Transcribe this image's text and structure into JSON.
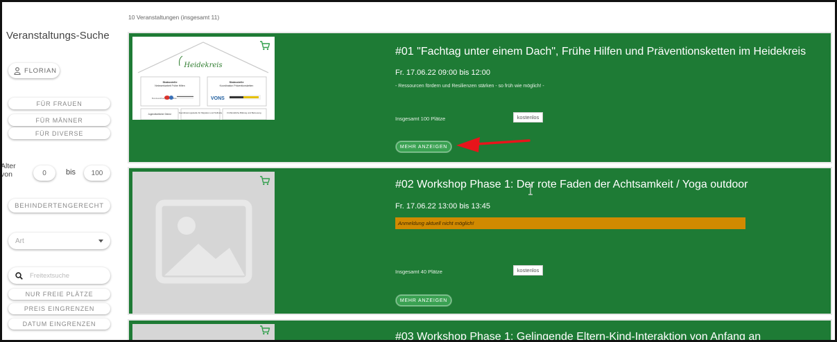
{
  "sidebar": {
    "title": "Veranstaltungs-Suche",
    "user_label": "FLORIAN",
    "gender_buttons": [
      "FÜR FRAUEN",
      "FÜR MÄNNER",
      "FÜR DIVERSE"
    ],
    "age": {
      "label": "Alter von",
      "from": "0",
      "to_label": "bis",
      "to": "100"
    },
    "accessible_label": "BEHINDERTENGERECHT",
    "type_select": {
      "selected": "Art"
    },
    "search": {
      "placeholder": "Freitextsuche"
    },
    "filters": [
      "NUR FREIE PLÄTZE",
      "PREIS EINGRENZEN",
      "DATUM EINGRENZEN"
    ]
  },
  "results": {
    "count_text": "10 Veranstaltungen (insgesamt 11)"
  },
  "events": [
    {
      "title": "#01 \"Fachtag unter einem Dach\", Frühe Hilfen und Präventionsketten im Heidekreis",
      "date": "Fr. 17.06.22 09:00 bis 12:00",
      "description": "- Ressourcen fördern und Resilienzen stärken - so früh wie möglich! -",
      "places": "Insgesamt 100 Plätze",
      "price": "kostenlos",
      "more_label": "MEHR ANZEIGEN",
      "image": {
        "logo": "Heidekreis",
        "boxes": [
          {
            "title": "Stabsstelle",
            "subtitle": "Netzwerkarbeit Frühe Hilfen"
          },
          {
            "title": "Stabsstelle",
            "subtitle": "Koordination Präventionsketten"
          }
        ],
        "bottom": [
          "Jugendärztlicher Dienst",
          "Koordinierungsstelle für Migration und Teilhabe",
          "Frühkindliche Bildung und Betreuung"
        ],
        "logos": [
          "Bundesstiftung Frühe Hilfen",
          "VONS"
        ]
      }
    },
    {
      "title": "#02 Workshop Phase 1: Der rote Faden der Achtsamkeit / Yoga outdoor",
      "date": "Fr. 17.06.22 13:00 bis 13:45",
      "warning": "Anmeldung aktuell nicht möglich!",
      "places": "Insgesamt 40 Plätze",
      "price": "kostenlos",
      "more_label": "MEHR ANZEIGEN"
    },
    {
      "title": "#03 Workshop Phase 1: Gelingende Eltern-Kind-Interaktion von Anfang an"
    }
  ],
  "colors": {
    "card_green": "#1e7b35",
    "button_green": "#3aa152",
    "warning_orange": "#d18a00",
    "arrow_red": "#e8141b"
  }
}
